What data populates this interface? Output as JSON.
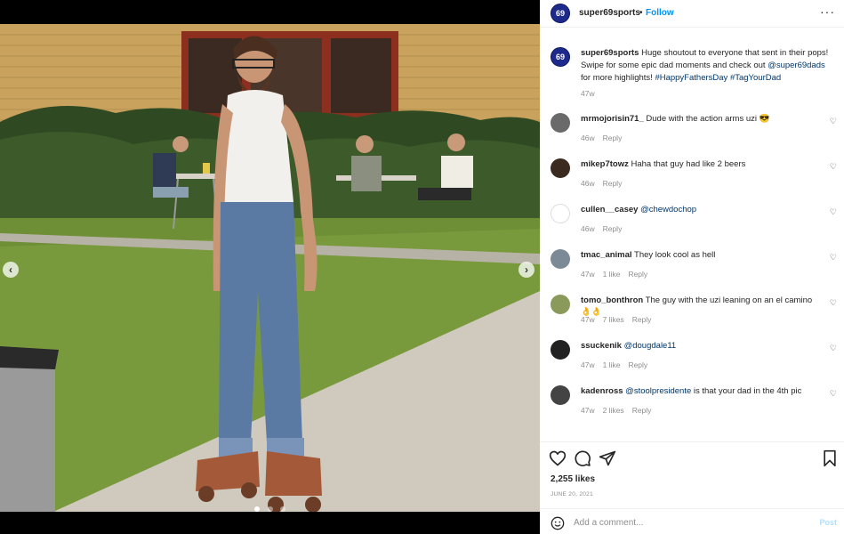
{
  "header": {
    "username": "super69sports",
    "separator": "•",
    "follow_label": "Follow",
    "more_label": "···",
    "avatar_text": "69"
  },
  "caption": {
    "username": "super69sports",
    "text_1": "Huge shoutout to everyone that sent in their pops! Swipe for some epic dad moments and check out ",
    "mention": "@super69dads",
    "text_2": " for more highlights! ",
    "hashtag_1": "#HappyFathersDay",
    "hashtag_2": "#TagYourDad",
    "age": "47w"
  },
  "comments": [
    {
      "username": "mrmojorisin71_",
      "text": "Dude with the action arms uzi 😎",
      "mention": "",
      "rest": "",
      "age": "46w",
      "likes": "",
      "reply": "Reply",
      "avatar_color": "#6a6a6a"
    },
    {
      "username": "mikep7towz",
      "text": "Haha that guy had like 2 beers",
      "mention": "",
      "rest": "",
      "age": "46w",
      "likes": "",
      "reply": "Reply",
      "avatar_color": "#3b2a20"
    },
    {
      "username": "cullen__casey",
      "text": "",
      "mention": "@chewdochop",
      "rest": "",
      "age": "46w",
      "likes": "",
      "reply": "Reply",
      "avatar_color": "#ffffff"
    },
    {
      "username": "tmac_animal",
      "text": "They look cool as hell",
      "mention": "",
      "rest": "",
      "age": "47w",
      "likes": "1 like",
      "reply": "Reply",
      "avatar_color": "#7b8a96"
    },
    {
      "username": "tomo_bonthron",
      "text": "The guy with the uzi leaning on an el camino 👌👌",
      "mention": "",
      "rest": "",
      "age": "47w",
      "likes": "7 likes",
      "reply": "Reply",
      "avatar_color": "#8a9a5a"
    },
    {
      "username": "ssuckenik",
      "text": "",
      "mention": "@dougdale11",
      "rest": "",
      "age": "47w",
      "likes": "1 like",
      "reply": "Reply",
      "avatar_color": "#222222"
    },
    {
      "username": "kadenross",
      "text": "",
      "mention": "@stoolpresidente",
      "rest": " is that your dad in the 4th pic",
      "age": "47w",
      "likes": "2 likes",
      "reply": "Reply",
      "avatar_color": "#444444"
    }
  ],
  "actions": {
    "like_icon": "heart-icon",
    "comment_icon": "comment-icon",
    "share_icon": "send-icon",
    "save_icon": "bookmark-icon",
    "likes": "2,255 likes",
    "date": "JUNE 20, 2021"
  },
  "add_comment": {
    "placeholder": "Add a comment...",
    "post_label": "Post",
    "emoji_icon": "emoji-icon"
  },
  "media": {
    "prev_label": "‹",
    "next_label": "›",
    "colors": {
      "brand": "#1d2a8c",
      "link": "#00376b",
      "follow": "#0095f6"
    }
  }
}
